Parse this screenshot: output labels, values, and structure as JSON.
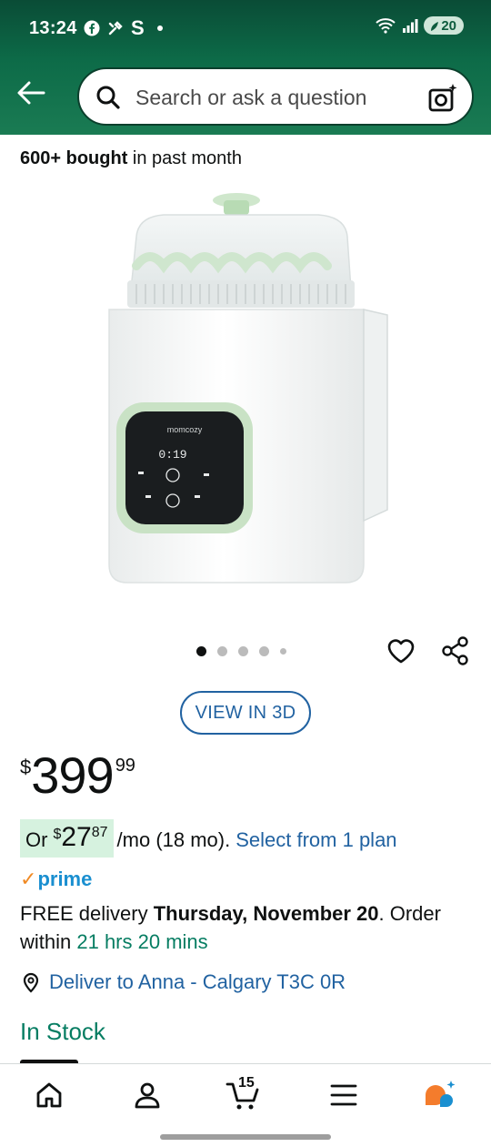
{
  "status_bar": {
    "time": "13:24",
    "left_icons": [
      "facebook-icon",
      "tools-icon",
      "s-icon"
    ],
    "battery": "20"
  },
  "search": {
    "placeholder": "Search or ask a question"
  },
  "social_proof": {
    "count": "600+ bought",
    "suffix": " in past month"
  },
  "gallery": {
    "image_count": 5,
    "active_index": 0,
    "view3d_label": "VIEW IN 3D"
  },
  "price": {
    "currency": "$",
    "whole": "399",
    "fraction": "99"
  },
  "installment": {
    "or": "Or",
    "currency": "$",
    "whole": "27",
    "fraction": "87",
    "term": "/mo (18 mo).",
    "link": "Select from 1 plan"
  },
  "prime": {
    "label": "prime"
  },
  "delivery": {
    "prefix": "FREE delivery ",
    "date": "Thursday, November 20",
    "mid": ". Order within ",
    "countdown": "21 hrs 20 mins"
  },
  "deliver_to": {
    "label": "Deliver to Anna - Calgary T3C 0R"
  },
  "stock": {
    "label": "In Stock"
  },
  "bottom_nav": {
    "cart_count": "15",
    "items": [
      "home-icon",
      "account-icon",
      "cart-icon",
      "menu-icon",
      "rufus-icon"
    ]
  },
  "colors": {
    "header": "#0d6b48",
    "link": "#2162a1",
    "in_stock": "#067d62",
    "prime": "#1a8fd0",
    "chip": "#d6f2df"
  }
}
